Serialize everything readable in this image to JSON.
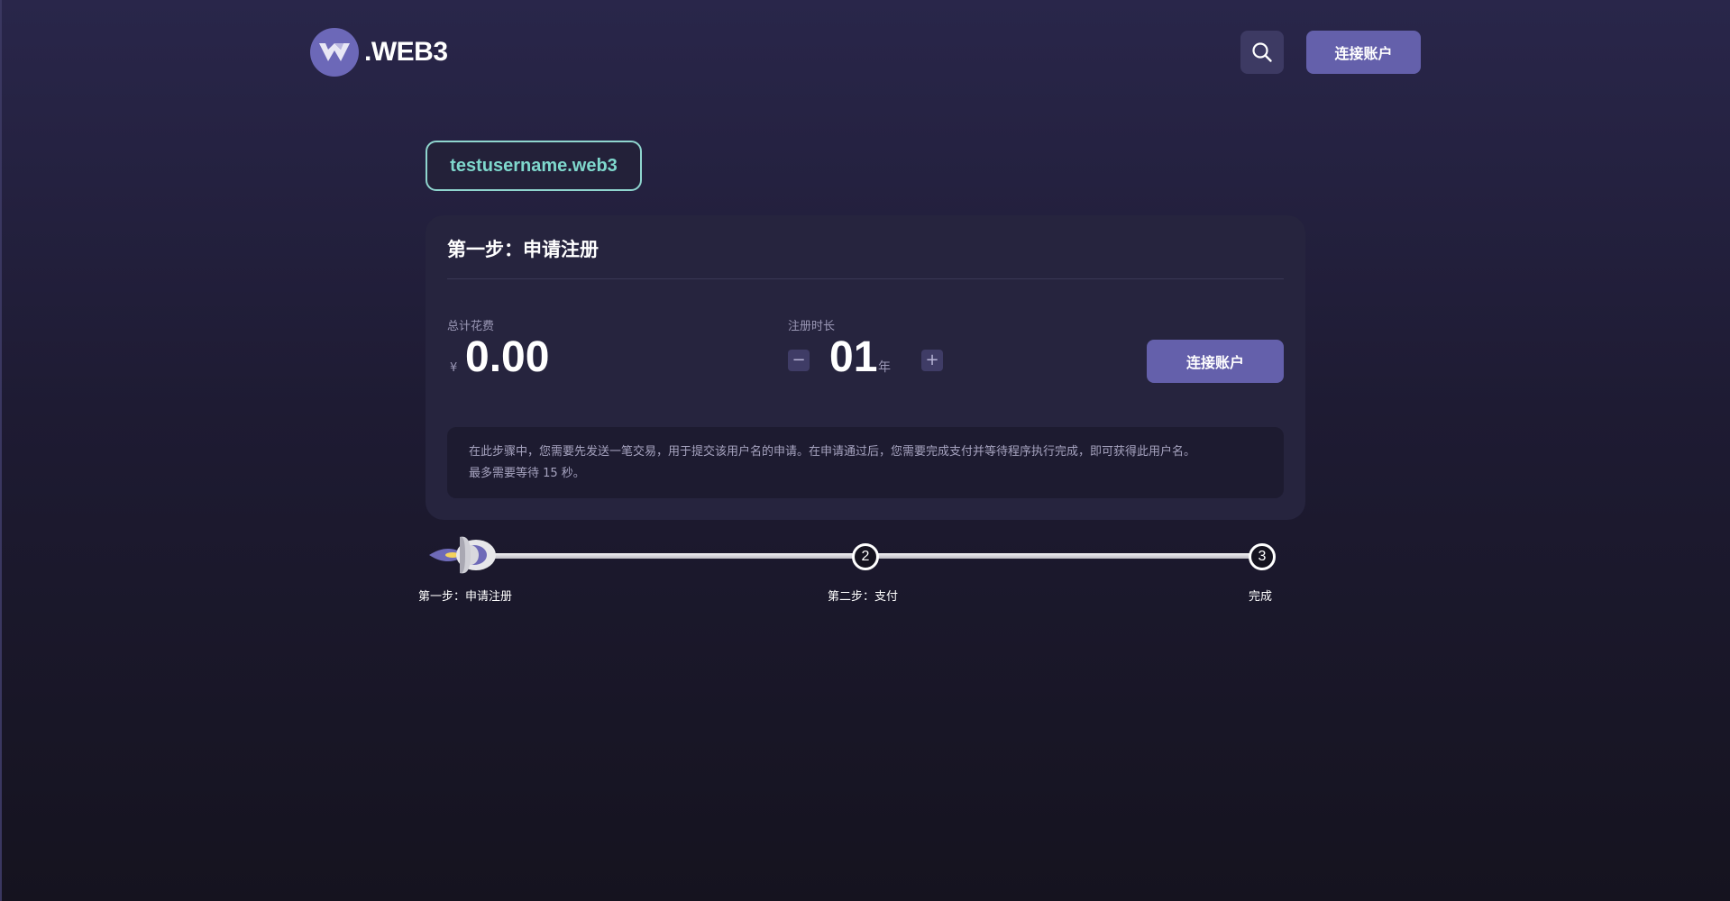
{
  "header": {
    "logo_text": ".WEB3",
    "search_icon": "search-icon",
    "connect_label": "连接账户"
  },
  "username": "testusername.web3",
  "card": {
    "title": "第一步：申请注册",
    "fee_label": "总计花费",
    "fee_currency": "¥",
    "fee_value": "0.00",
    "duration_label": "注册时长",
    "duration_value": "01",
    "duration_unit": "年",
    "minus_symbol": "−",
    "plus_symbol": "+",
    "connect_label": "连接账户",
    "notice_line1": "在此步骤中，您需要先发送一笔交易，用于提交该用户名的申请。在申请通过后，您需要完成支付并等待程序执行完成，即可获得此用户名。",
    "notice_line2": "最多需要等待 15 秒。"
  },
  "progress": {
    "current_step": 1,
    "steps": [
      {
        "number": "1",
        "label": "第一步：申请注册"
      },
      {
        "number": "2",
        "label": "第二步：支付"
      },
      {
        "number": "3",
        "label": "完成"
      }
    ]
  },
  "colors": {
    "accent": "#6460ab",
    "username_text": "#7fd8cd",
    "card_bg": "#26243e"
  }
}
